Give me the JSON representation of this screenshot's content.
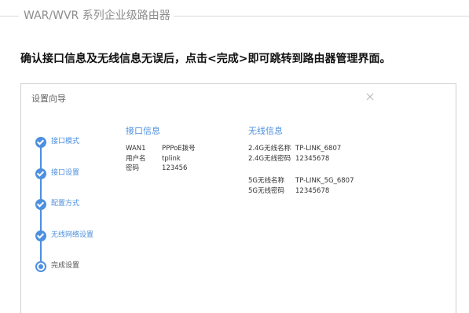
{
  "doc": {
    "title": "WAR/WVR 系列企业级路由器",
    "instruction_pre": "确认接口信息及无线信息无误后，点击",
    "instruction_bold": "<完成>",
    "instruction_post": "即可跳转到路由器管理界面。"
  },
  "dialog": {
    "title": "设置向导",
    "close_icon": "close-icon",
    "steps": [
      {
        "label": "接口模式",
        "state": "done"
      },
      {
        "label": "接口设置",
        "state": "done"
      },
      {
        "label": "配置方式",
        "state": "done"
      },
      {
        "label": "无线网络设置",
        "state": "done"
      },
      {
        "label": "完成设置",
        "state": "current"
      }
    ],
    "interface": {
      "title": "接口信息",
      "rows": [
        {
          "key": "WAN1",
          "value": "PPPoE拨号"
        },
        {
          "key": "用户名",
          "value": "tplink"
        },
        {
          "key": "密码",
          "value": "123456"
        }
      ]
    },
    "wireless": {
      "title": "无线信息",
      "band24": [
        {
          "key": "2.4G无线名称",
          "value": "TP-LINK_6807"
        },
        {
          "key": "2.4G无线密码",
          "value": "12345678"
        }
      ],
      "band5": [
        {
          "key": "5G无线名称",
          "value": "TP-LINK_5G_6807"
        },
        {
          "key": "5G无线密码",
          "value": "12345678"
        }
      ]
    }
  },
  "colors": {
    "accent": "#4d8fe0",
    "border": "#cfcfcf",
    "muted": "#8c8c8c"
  }
}
